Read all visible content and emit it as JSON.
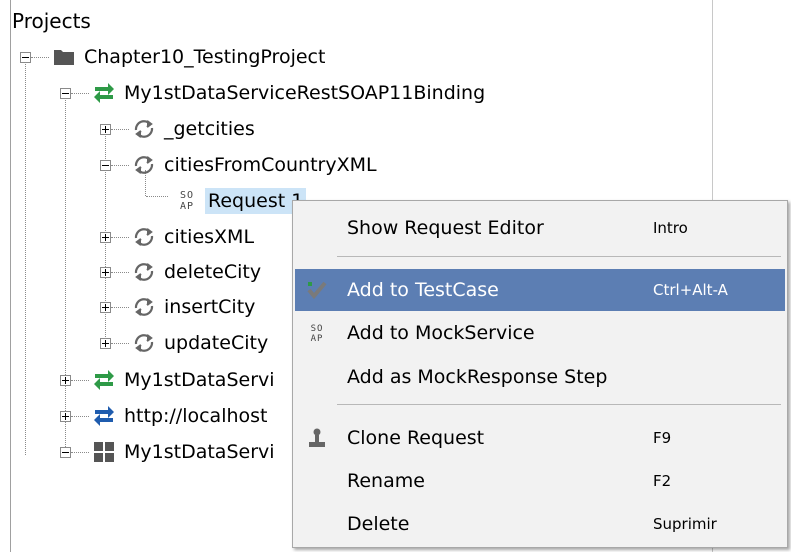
{
  "tree": {
    "root_label": "Projects",
    "project": "Chapter10_TestingProject",
    "interface1": "My1stDataServiceRestSOAP11Binding",
    "operations": [
      {
        "label": "_getcities"
      },
      {
        "label": "citiesFromCountryXML"
      },
      {
        "label": "citiesXML"
      },
      {
        "label": "deleteCity"
      },
      {
        "label": "insertCity"
      },
      {
        "label": "updateCity"
      }
    ],
    "request": "Request 1",
    "request_icon_text": "SO AP",
    "interface2": "My1stDataServi",
    "interface3": "http://localhost",
    "interface4": "My1stDataServi",
    "colors": {
      "rest_green": "#2e9a47",
      "rest_blue": "#1f5cae",
      "folder": "#555555",
      "selection": "#cce4f7"
    }
  },
  "context_menu": {
    "items": [
      {
        "label": "Show Request Editor",
        "shortcut": "Intro",
        "icon": ""
      },
      {
        "label": "Add to TestCase",
        "shortcut": "Ctrl+Alt-A",
        "icon": "add-testcase-icon"
      },
      {
        "label": "Add to MockService",
        "shortcut": "",
        "icon": "soap-icon"
      },
      {
        "label": "Add as MockResponse Step",
        "shortcut": "",
        "icon": ""
      },
      {
        "label": "Clone Request",
        "shortcut": "F9",
        "icon": "clone-icon"
      },
      {
        "label": "Rename",
        "shortcut": "F2",
        "icon": ""
      },
      {
        "label": "Delete",
        "shortcut": "Suprimir",
        "icon": ""
      }
    ],
    "highlight_color": "#5c7eb3"
  }
}
